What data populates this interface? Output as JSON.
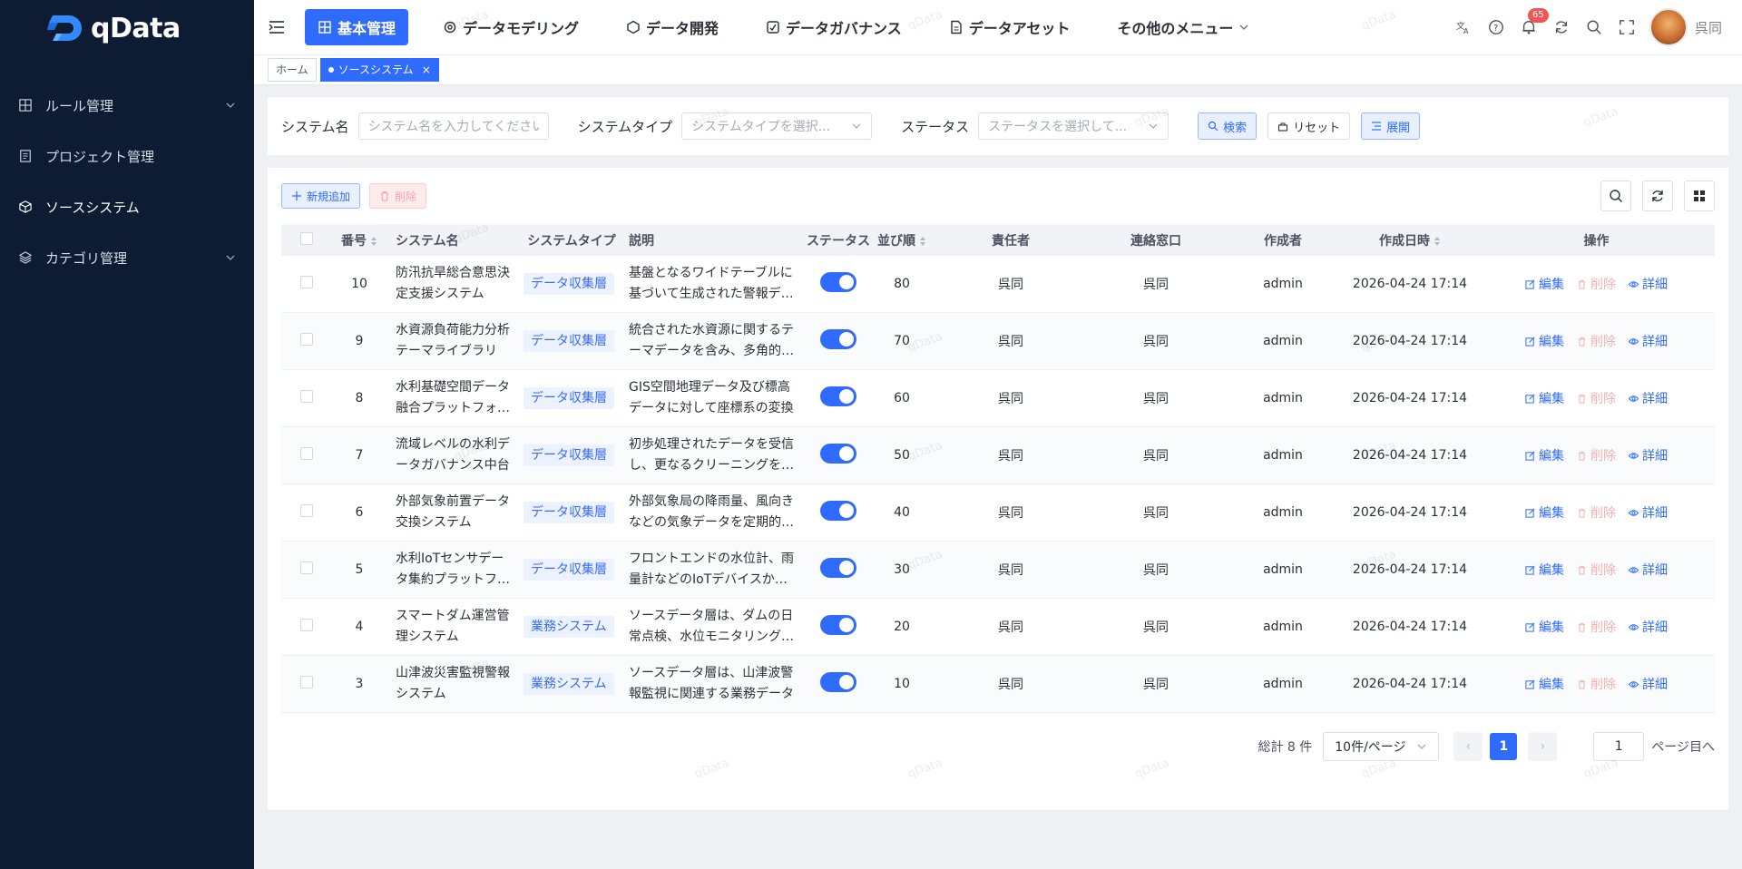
{
  "app": {
    "logo_text": "qData",
    "user_name": "呉同",
    "notification_count": "65",
    "watermark": "qData"
  },
  "sidebar": {
    "items": [
      {
        "label": "ルール管理",
        "icon": "grid-icon",
        "expandable": true
      },
      {
        "label": "プロジェクト管理",
        "icon": "document-icon",
        "expandable": false
      },
      {
        "label": "ソースシステム",
        "icon": "cube-icon",
        "expandable": false
      },
      {
        "label": "カテゴリ管理",
        "icon": "layers-icon",
        "expandable": true
      }
    ]
  },
  "topnav": {
    "tabs": [
      {
        "label": "基本管理",
        "active": true
      },
      {
        "label": "データモデリング",
        "active": false
      },
      {
        "label": "データ開発",
        "active": false
      },
      {
        "label": "データガバナンス",
        "active": false
      },
      {
        "label": "データアセット",
        "active": false
      },
      {
        "label": "その他のメニュー",
        "active": false
      }
    ]
  },
  "tags": {
    "home": "ホーム",
    "current": "ソースシステム"
  },
  "search": {
    "name_label": "システム名",
    "name_placeholder": "システム名を入力してください",
    "type_label": "システムタイプ",
    "type_placeholder": "システムタイプを選択...",
    "status_label": "ステータス",
    "status_placeholder": "ステータスを選択して...",
    "search_btn": "検索",
    "reset_btn": "リセット",
    "expand_btn": "展開"
  },
  "toolbar": {
    "add_btn": "新規追加",
    "delete_btn": "削除"
  },
  "table": {
    "columns": [
      "番号",
      "システム名",
      "システムタイプ",
      "説明",
      "ステータス",
      "並び順",
      "責任者",
      "連絡窓口",
      "作成者",
      "作成日時",
      "操作"
    ],
    "op_labels": {
      "edit": "編集",
      "delete": "削除",
      "detail": "詳細"
    },
    "rows": [
      {
        "no": "10",
        "name": "防汛抗旱総合意思決定支援システム",
        "type": "データ収集層",
        "desc": "基盤となるワイドテーブルに基づいて生成された警報データ",
        "status": true,
        "order": "80",
        "owner": "呉同",
        "contact": "呉同",
        "creator": "admin",
        "created": "2026-04-24 17:14"
      },
      {
        "no": "9",
        "name": "水資源負荷能力分析テーマライブラリ",
        "type": "データ収集層",
        "desc": "統合された水資源に関するテーマデータを含み、多角的な分析",
        "status": true,
        "order": "70",
        "owner": "呉同",
        "contact": "呉同",
        "creator": "admin",
        "created": "2026-04-24 17:14"
      },
      {
        "no": "8",
        "name": "水利基礎空間データ融合プラットフォーム",
        "type": "データ収集層",
        "desc": "GIS空間地理データ及び標高データに対して座標系の変換",
        "status": true,
        "order": "60",
        "owner": "呉同",
        "contact": "呉同",
        "creator": "admin",
        "created": "2026-04-24 17:14"
      },
      {
        "no": "7",
        "name": "流域レベルの水利データガバナンス中台",
        "type": "データ収集層",
        "desc": "初歩処理されたデータを受信し、更なるクリーニングを実施",
        "status": true,
        "order": "50",
        "owner": "呉同",
        "contact": "呉同",
        "creator": "admin",
        "created": "2026-04-24 17:14"
      },
      {
        "no": "6",
        "name": "外部気象前置データ交換システム",
        "type": "データ収集層",
        "desc": "外部気象局の降雨量、風向きなどの気象データを定期的に取得",
        "status": true,
        "order": "40",
        "owner": "呉同",
        "contact": "呉同",
        "creator": "admin",
        "created": "2026-04-24 17:14"
      },
      {
        "no": "5",
        "name": "水利IoTセンサデータ集約プラットフォーム",
        "type": "データ収集層",
        "desc": "フロントエンドの水位計、雨量計などのIoTデバイスからのデータ",
        "status": true,
        "order": "30",
        "owner": "呉同",
        "contact": "呉同",
        "creator": "admin",
        "created": "2026-04-24 17:14"
      },
      {
        "no": "4",
        "name": "スマートダム運営管理システム",
        "type": "業務システム",
        "desc": "ソースデータ層は、ダムの日常点検、水位モニタリングなど",
        "status": true,
        "order": "20",
        "owner": "呉同",
        "contact": "呉同",
        "creator": "admin",
        "created": "2026-04-24 17:14"
      },
      {
        "no": "3",
        "name": "山津波災害監視警報システム",
        "type": "業務システム",
        "desc": "ソースデータ層は、山津波警報監視に関連する業務データ",
        "status": true,
        "order": "10",
        "owner": "呉同",
        "contact": "呉同",
        "creator": "admin",
        "created": "2026-04-24 17:14"
      }
    ]
  },
  "pagination": {
    "total_text": "総計 8 件",
    "page_size": "10件/ページ",
    "current_page": "1",
    "jump_value": "1",
    "jump_suffix": "ページ目へ"
  },
  "colors": {
    "sidebar_bg": "#0d1b33",
    "accent": "#2f6bff",
    "danger_light": "#f3b0b0"
  }
}
